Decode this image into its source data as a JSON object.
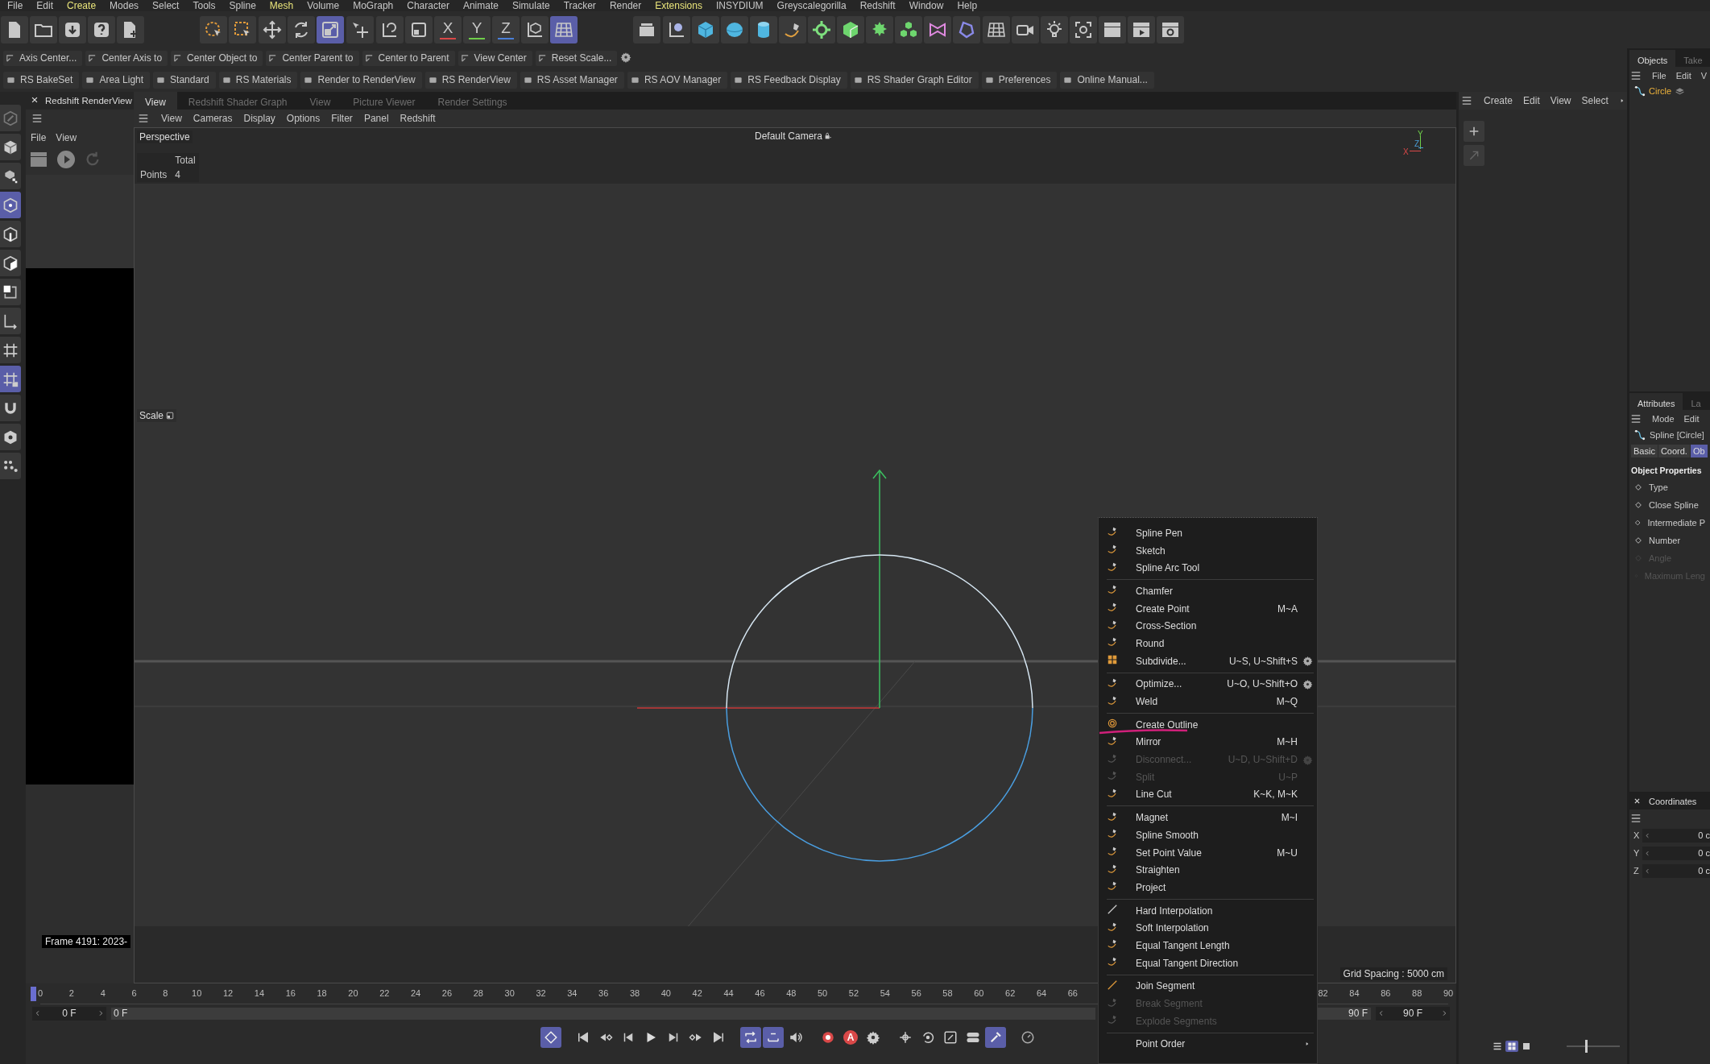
{
  "menu_bar": [
    {
      "label": "File",
      "highlighted": false
    },
    {
      "label": "Edit",
      "highlighted": false
    },
    {
      "label": "Create",
      "highlighted": true
    },
    {
      "label": "Modes",
      "highlighted": false
    },
    {
      "label": "Select",
      "highlighted": false
    },
    {
      "label": "Tools",
      "highlighted": false
    },
    {
      "label": "Spline",
      "highlighted": false
    },
    {
      "label": "Mesh",
      "highlighted": true
    },
    {
      "label": "Volume",
      "highlighted": false
    },
    {
      "label": "MoGraph",
      "highlighted": false
    },
    {
      "label": "Character",
      "highlighted": false
    },
    {
      "label": "Animate",
      "highlighted": false
    },
    {
      "label": "Simulate",
      "highlighted": false
    },
    {
      "label": "Tracker",
      "highlighted": false
    },
    {
      "label": "Render",
      "highlighted": false
    },
    {
      "label": "Extensions",
      "highlighted": true
    },
    {
      "label": "INSYDIUM",
      "highlighted": false
    },
    {
      "label": "Greyscalegorilla",
      "highlighted": false
    },
    {
      "label": "Redshift",
      "highlighted": false
    },
    {
      "label": "Window",
      "highlighted": false
    },
    {
      "label": "Help",
      "highlighted": false
    }
  ],
  "toolbar": [
    [
      {
        "selected": false
      },
      {
        "selected": false
      },
      {
        "selected": false
      },
      {
        "selected": false
      },
      {
        "selected": false
      }
    ],
    [
      {
        "selected": false
      },
      {
        "selected": false
      }
    ],
    [
      {
        "selected": false
      },
      {
        "selected": false
      },
      {
        "selected": true
      }
    ],
    [
      {
        "selected": false
      }
    ],
    [
      {
        "selected": false
      },
      {
        "selected": false
      },
      {
        "label": "X",
        "color": "#d94848",
        "selected": false
      },
      {
        "label": "Y",
        "color": "#6fcf4a",
        "selected": false
      },
      {
        "label": "Z",
        "color": "#4a7fd9",
        "selected": false
      },
      {
        "selected": false
      },
      {
        "selected": true
      }
    ],
    [
      {
        "selected": false
      }
    ],
    [
      {
        "selected": false
      },
      {
        "selected": false
      },
      {
        "selected": false
      },
      {
        "selected": false
      },
      {
        "selected": false
      },
      {
        "selected": false
      },
      {
        "selected": false
      },
      {
        "selected": false
      },
      {
        "selected": false
      },
      {
        "selected": false
      },
      {
        "selected": false
      }
    ],
    [
      {
        "selected": false
      },
      {
        "selected": false
      },
      {
        "selected": false
      },
      {
        "selected": false
      },
      {
        "selected": false
      },
      {
        "selected": false
      },
      {
        "selected": false
      }
    ]
  ],
  "command_rows": [
    [
      "Axis Center...",
      "Center Axis to",
      "Center Object to",
      "Center Parent to",
      "Center to Parent",
      "View Center",
      "Reset Scale..."
    ],
    [
      "RS BakeSet",
      "Area Light",
      "Standard",
      "RS Materials",
      "Render to RenderView",
      "RS RenderView",
      "RS Asset Manager",
      "RS AOV Manager",
      "RS Feedback Display",
      "RS Shader Graph Editor",
      "Preferences",
      "Online Manual..."
    ]
  ],
  "mode_bar": [
    {
      "selected": false
    },
    {
      "selected": false
    },
    {
      "selected": false
    },
    {
      "selected": true
    },
    {
      "selected": false
    },
    {
      "selected": false
    },
    {
      "selected": false
    },
    {
      "selected": false
    },
    {
      "selected": false
    },
    {
      "selected": true
    },
    {
      "selected": false
    },
    {
      "selected": false
    },
    {
      "selected": false
    }
  ],
  "render_view": {
    "title": "Redshift RenderView",
    "menu": [
      "File",
      "View"
    ],
    "frame_label": "Frame 4191: 2023-"
  },
  "viewport": {
    "tabs": [
      {
        "label": "View",
        "selected": true
      },
      {
        "label": "Redshift Shader Graph",
        "selected": false
      },
      {
        "label": "View",
        "selected": false
      },
      {
        "label": "Picture Viewer",
        "selected": false
      },
      {
        "label": "Render Settings",
        "selected": false
      }
    ],
    "menu": [
      "View",
      "Cameras",
      "Display",
      "Options",
      "Filter",
      "Panel",
      "Redshift"
    ],
    "camera": "Perspective",
    "camera_name": "Default Camera",
    "stats": {
      "header": "Total",
      "rows": [
        {
          "label": "Points",
          "value": "4"
        }
      ]
    },
    "active_tool": "Scale",
    "axis_widget": [
      {
        "label": "Y",
        "color": "#6fcf4a"
      },
      {
        "label": "Z",
        "color": "#4a9fd9"
      },
      {
        "label": "X",
        "color": "#d94848"
      }
    ],
    "grid_spacing": "Grid Spacing : 5000 cm"
  },
  "palette": {
    "menu": [
      "Create",
      "Edit",
      "View",
      "Select"
    ],
    "layouts": [
      {
        "selected": false
      },
      {
        "selected": true
      },
      {
        "selected": false
      }
    ],
    "zoom": {
      "level": 0.35
    }
  },
  "objects": {
    "tabs": [
      {
        "label": "Objects",
        "selected": true
      },
      {
        "label": "Take",
        "selected": false
      }
    ],
    "menu": [
      "File",
      "Edit",
      "V"
    ],
    "items": [
      {
        "name": "Circle",
        "selected": true
      }
    ]
  },
  "attributes": {
    "tabs": [
      {
        "label": "Attributes",
        "selected": true
      },
      {
        "label": "La",
        "selected": false
      }
    ],
    "menu": [
      "Mode",
      "Edit"
    ],
    "title": "Spline [Circle]",
    "subtabs": [
      {
        "label": "Basic",
        "selected": false
      },
      {
        "label": "Coord.",
        "selected": false
      },
      {
        "label": "Ob",
        "selected": true
      }
    ],
    "section": "Object Properties",
    "properties": [
      {
        "label": "Type",
        "disabled": false
      },
      {
        "label": "Close Spline",
        "disabled": false
      },
      {
        "label": "Intermediate P",
        "disabled": false
      },
      {
        "label": "Number",
        "disabled": false
      },
      {
        "label": "Angle",
        "disabled": true
      },
      {
        "label": "Maximum Leng",
        "disabled": true
      }
    ]
  },
  "coordinates": {
    "title": "Coordinates",
    "rows": [
      {
        "axis": "X",
        "value": "0 c"
      },
      {
        "axis": "Y",
        "value": "0 c"
      },
      {
        "axis": "Z",
        "value": "0 c"
      }
    ]
  },
  "timeline": {
    "ticks": [
      "0",
      "2",
      "4",
      "6",
      "8",
      "10",
      "12",
      "14",
      "16",
      "18",
      "20",
      "22",
      "24",
      "26",
      "28",
      "30",
      "32",
      "34",
      "36",
      "38",
      "40",
      "42",
      "44",
      "46",
      "48",
      "50",
      "52",
      "54",
      "56",
      "58",
      "60",
      "62",
      "64",
      "66",
      "82",
      "84",
      "86",
      "88",
      "90"
    ],
    "playhead": {
      "level": 0
    },
    "start": "0 F",
    "current": "0 F",
    "end": "90 F",
    "max": "90 F",
    "transport": [
      [
        {
          "selected": true
        }
      ],
      [
        {
          "selected": false
        },
        {
          "selected": false
        },
        {
          "selected": false
        },
        {
          "selected": false
        },
        {
          "selected": false
        },
        {
          "selected": false
        },
        {
          "selected": false
        }
      ],
      [
        {
          "selected": true
        },
        {
          "selected": true
        },
        {
          "selected": false
        }
      ],
      [
        {
          "selected": false
        },
        {
          "label": "A",
          "selected": false
        },
        {
          "selected": false
        }
      ],
      [
        {
          "selected": false
        },
        {
          "selected": false
        },
        {
          "selected": false
        },
        {
          "selected": false
        },
        {
          "selected": true
        }
      ],
      [
        {
          "selected": false
        }
      ]
    ]
  },
  "context_menu": {
    "groups": [
      [
        {
          "kind": "item",
          "label": "Spline Pen",
          "disabled": false,
          "marked": false
        },
        {
          "kind": "item",
          "label": "Sketch",
          "disabled": false,
          "marked": false
        },
        {
          "kind": "item",
          "label": "Spline Arc Tool",
          "disabled": false,
          "marked": false
        }
      ],
      [
        {
          "kind": "item",
          "label": "Chamfer",
          "disabled": false,
          "marked": false
        },
        {
          "kind": "item",
          "label": "Create Point",
          "shortcut": "M~A",
          "disabled": false,
          "marked": false
        },
        {
          "kind": "item",
          "label": "Cross-Section",
          "disabled": false,
          "marked": false
        },
        {
          "kind": "item",
          "label": "Round",
          "disabled": false,
          "marked": false
        },
        {
          "kind": "options",
          "label": "Subdivide...",
          "shortcut": "U~S, U~Shift+S",
          "disabled": false,
          "marked": false
        }
      ],
      [
        {
          "kind": "options",
          "label": "Optimize...",
          "shortcut": "U~O, U~Shift+O",
          "disabled": false,
          "marked": false
        },
        {
          "kind": "item",
          "label": "Weld",
          "shortcut": "M~Q",
          "disabled": false,
          "marked": false
        }
      ],
      [
        {
          "kind": "item",
          "label": "Create Outline",
          "disabled": false,
          "marked": true
        },
        {
          "kind": "item",
          "label": "Mirror",
          "shortcut": "M~H",
          "disabled": false,
          "marked": false
        },
        {
          "kind": "options",
          "label": "Disconnect...",
          "shortcut": "U~D, U~Shift+D",
          "disabled": true,
          "marked": false
        },
        {
          "kind": "item",
          "label": "Split",
          "shortcut": "U~P",
          "disabled": true,
          "marked": false
        },
        {
          "kind": "item",
          "label": "Line Cut",
          "shortcut": "K~K, M~K",
          "disabled": false,
          "marked": false
        }
      ],
      [
        {
          "kind": "item",
          "label": "Magnet",
          "shortcut": "M~I",
          "disabled": false,
          "marked": false
        },
        {
          "kind": "item",
          "label": "Spline Smooth",
          "disabled": false,
          "marked": false
        },
        {
          "kind": "item",
          "label": "Set Point Value",
          "shortcut": "M~U",
          "disabled": false,
          "marked": false
        },
        {
          "kind": "item",
          "label": "Straighten",
          "disabled": false,
          "marked": false
        },
        {
          "kind": "item",
          "label": "Project",
          "disabled": false,
          "marked": false
        }
      ],
      [
        {
          "kind": "item",
          "label": "Hard Interpolation",
          "disabled": false,
          "marked": false
        },
        {
          "kind": "item",
          "label": "Soft Interpolation",
          "disabled": false,
          "marked": false
        },
        {
          "kind": "item",
          "label": "Equal Tangent Length",
          "disabled": false,
          "marked": false
        },
        {
          "kind": "item",
          "label": "Equal Tangent Direction",
          "disabled": false,
          "marked": false
        }
      ],
      [
        {
          "kind": "item",
          "label": "Join Segment",
          "disabled": false,
          "marked": false
        },
        {
          "kind": "item",
          "label": "Break Segment",
          "disabled": true,
          "marked": false
        },
        {
          "kind": "item",
          "label": "Explode Segments",
          "disabled": true,
          "marked": false
        }
      ],
      [
        {
          "kind": "submenu",
          "label": "Point Order",
          "disabled": false,
          "marked": false
        }
      ]
    ]
  }
}
